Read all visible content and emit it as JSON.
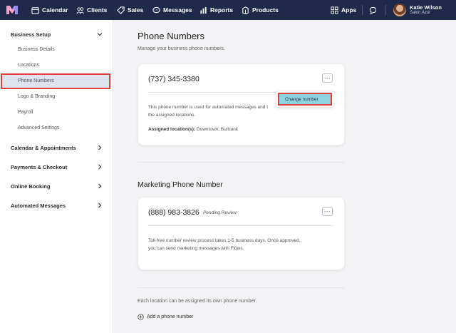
{
  "nav": {
    "items": [
      {
        "label": "Calendar",
        "icon": "calendar-icon"
      },
      {
        "label": "Clients",
        "icon": "people-icon"
      },
      {
        "label": "Sales",
        "icon": "tag-icon"
      },
      {
        "label": "Messages",
        "icon": "chat-icon"
      },
      {
        "label": "Reports",
        "icon": "bar-chart-icon"
      },
      {
        "label": "Products",
        "icon": "box-icon"
      }
    ],
    "apps_label": "Apps",
    "user_name": "Katie Wilson",
    "user_business": "Salon Azul"
  },
  "sidebar": {
    "section": "Business Setup",
    "sub_items": [
      "Business Details",
      "Locations",
      "Phone Numbers",
      "Logo & Branding",
      "Payroll",
      "Advanced Settings"
    ],
    "active": "Phone Numbers",
    "groups": [
      "Calendar & Appointments",
      "Payments & Checkout",
      "Online Booking",
      "Automated Messages"
    ]
  },
  "main": {
    "title": "Phone Numbers",
    "subtitle": "Manage your business phone numbers.",
    "card1": {
      "phone": "(737) 345-3380",
      "desc_line1": "This phone number is used for automated messages and t",
      "desc_line2": "the assigned locations.",
      "assigned_label": "Assigned location(s):",
      "assigned_value": "Downtown, Burbank",
      "menu_item": "Change number"
    },
    "marketing_title": "Marketing Phone Number",
    "card2": {
      "phone": "(888) 983-3826",
      "status": "Pending Review",
      "desc_line1": "Toll-free number review process takes 1-5 business days. Once approved,",
      "desc_line2": "you can send marketing messages with Flows."
    },
    "footer_text": "Each location can be assigned its own phone number.",
    "add_label": "Add a phone number"
  },
  "colors": {
    "nav_bg": "#1f2a4b",
    "highlight": "#e0403a",
    "menu_selected": "#8fd3e0"
  }
}
